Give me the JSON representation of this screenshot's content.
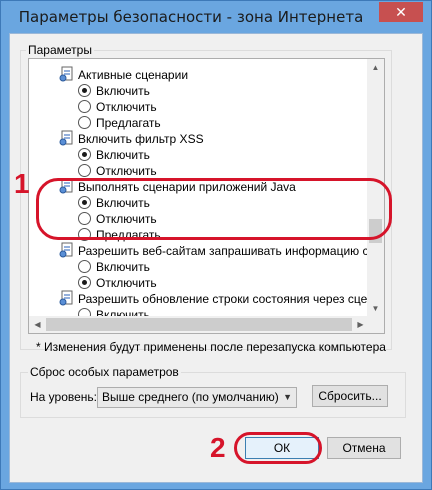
{
  "window": {
    "title": "Параметры безопасности - зона Интернета",
    "close_glyph": "✕"
  },
  "settings_group": {
    "label": "Параметры"
  },
  "settings_list": [
    {
      "heading": "Активные сценарии",
      "options": [
        {
          "label": "Включить",
          "selected": true
        },
        {
          "label": "Отключить",
          "selected": false
        },
        {
          "label": "Предлагать",
          "selected": false
        }
      ]
    },
    {
      "heading": "Включить фильтр XSS",
      "options": [
        {
          "label": "Включить",
          "selected": true
        },
        {
          "label": "Отключить",
          "selected": false
        }
      ]
    },
    {
      "heading": "Выполнять сценарии приложений Java",
      "options": [
        {
          "label": "Включить",
          "selected": true
        },
        {
          "label": "Отключить",
          "selected": false
        },
        {
          "label": "Предлагать",
          "selected": false
        }
      ]
    },
    {
      "heading": "Разрешить веб-сайтам запрашивать информацию с помо",
      "options": [
        {
          "label": "Включить",
          "selected": false
        },
        {
          "label": "Отключить",
          "selected": true
        }
      ]
    },
    {
      "heading": "Разрешить обновление строки состояния через сценарий",
      "options": [
        {
          "label": "Включить",
          "selected": false
        }
      ]
    }
  ],
  "note": "* Изменения будут применены после перезапуска компьютера",
  "reset_group": {
    "label": "Сброс особых параметров",
    "level_label": "На уровень:",
    "level_value": "Выше среднего (по умолчанию)",
    "reset_button": "Сбросить..."
  },
  "buttons": {
    "ok": "ОК",
    "cancel": "Отмена"
  },
  "callouts": {
    "one": "1",
    "two": "2",
    "color": "#d6142a"
  }
}
